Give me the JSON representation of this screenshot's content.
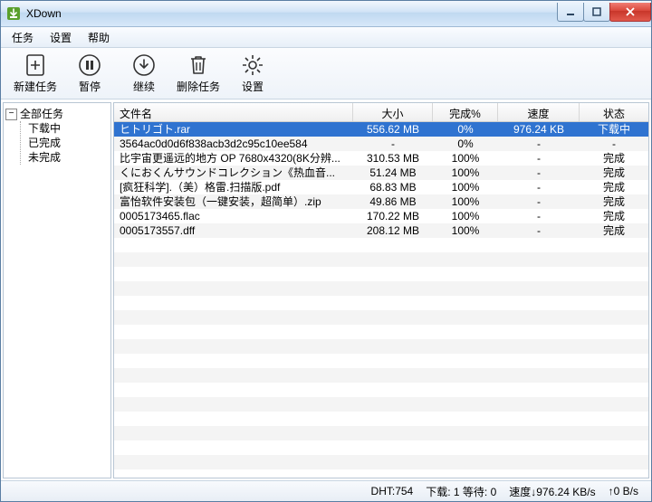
{
  "window": {
    "title": "XDown"
  },
  "menu": {
    "items": [
      "任务",
      "设置",
      "帮助"
    ]
  },
  "toolbar": {
    "new_task": "新建任务",
    "pause": "暂停",
    "resume": "继续",
    "delete": "删除任务",
    "settings": "设置"
  },
  "sidebar": {
    "root": "全部任务",
    "children": [
      "下载中",
      "已完成",
      "未完成"
    ]
  },
  "table": {
    "headers": {
      "name": "文件名",
      "size": "大小",
      "percent": "完成%",
      "speed": "速度",
      "status": "状态"
    },
    "rows": [
      {
        "name": "ヒトリゴト.rar",
        "size": "556.62 MB",
        "percent": "0%",
        "speed": "976.24 KB",
        "status": "下载中",
        "selected": true
      },
      {
        "name": "3564ac0d0d6f838acb3d2c95c10ee584",
        "size": "-",
        "percent": "0%",
        "speed": "-",
        "status": "-"
      },
      {
        "name": "比宇宙更遥远的地方 OP 7680x4320(8K分辨...",
        "size": "310.53 MB",
        "percent": "100%",
        "speed": "-",
        "status": "完成"
      },
      {
        "name": "くにおくんサウンドコレクション《热血音...",
        "size": "51.24 MB",
        "percent": "100%",
        "speed": "-",
        "status": "完成"
      },
      {
        "name": "[疯狂科学].（美）格雷.扫描版.pdf",
        "size": "68.83 MB",
        "percent": "100%",
        "speed": "-",
        "status": "完成"
      },
      {
        "name": "富怡软件安装包（一键安装，超简单）.zip",
        "size": "49.86 MB",
        "percent": "100%",
        "speed": "-",
        "status": "完成"
      },
      {
        "name": "0005173465.flac",
        "size": "170.22 MB",
        "percent": "100%",
        "speed": "-",
        "status": "完成"
      },
      {
        "name": "0005173557.dff",
        "size": "208.12 MB",
        "percent": "100%",
        "speed": "-",
        "status": "完成"
      }
    ]
  },
  "statusbar": {
    "dht": "DHT:754",
    "downloads": "下载: 1 等待: 0",
    "speed_down": "速度↓976.24 KB/s",
    "speed_up": "↑0 B/s"
  },
  "colors": {
    "selection": "#2f73d0"
  }
}
